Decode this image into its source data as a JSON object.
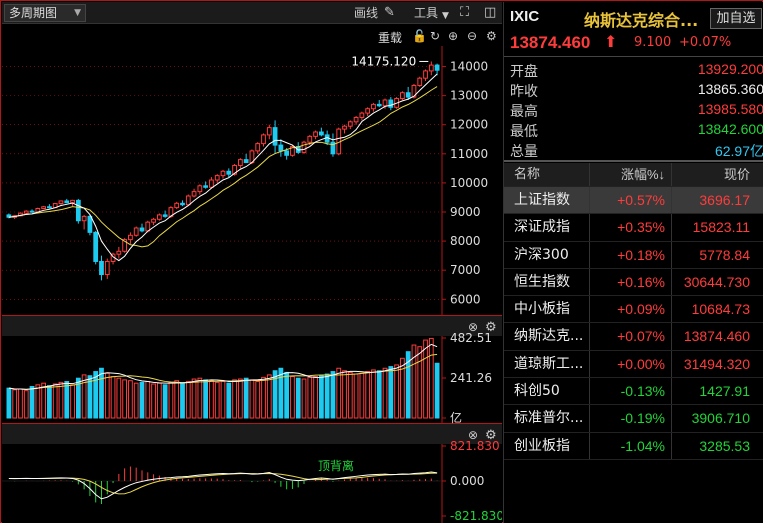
{
  "toolbar": {
    "period_label": "多周期图",
    "draw_label": "画线",
    "tools_label": "工具"
  },
  "kline": {
    "reset_label": "重载",
    "max_annotation": "14175.120",
    "price_ticks": [
      "14000",
      "13000",
      "12000",
      "11000",
      "10000",
      "9000",
      "8000",
      "7000",
      "6000"
    ],
    "volume_ticks": [
      "482.51",
      "241.26",
      "亿"
    ],
    "macd_ticks": [
      "821.830",
      "0.000",
      "-821.830"
    ],
    "macd_annotation": "顶背离",
    "colors": {
      "up": "#ff3c3c",
      "down": "#1ecbf0",
      "ma_fast": "#ffffff",
      "ma_slow": "#e8d84a",
      "grid": "#b01818"
    }
  },
  "quote": {
    "symbol": "IXIC",
    "name": "纳斯达克综合...",
    "add_fav": "加自选",
    "price": "13874.460",
    "change": "9.100",
    "change_pct": "+0.07%",
    "stats": [
      {
        "label": "开盘",
        "value": "13929.200",
        "color": "red"
      },
      {
        "label": "昨收",
        "value": "13865.360",
        "color": "white"
      },
      {
        "label": "最高",
        "value": "13985.580",
        "color": "red"
      },
      {
        "label": "最低",
        "value": "13842.600",
        "color": "green"
      },
      {
        "label": "总量",
        "value": "62.97亿",
        "color": "cyan"
      }
    ]
  },
  "index_table": {
    "headers": [
      "名称",
      "涨幅%↓",
      "现价"
    ],
    "rows": [
      {
        "name": "上证指数",
        "pct": "+0.57%",
        "price": "3696.17",
        "color": "red"
      },
      {
        "name": "深证成指",
        "pct": "+0.35%",
        "price": "15823.11",
        "color": "red"
      },
      {
        "name": "沪深300",
        "pct": "+0.18%",
        "price": "5778.84",
        "color": "red"
      },
      {
        "name": "恒生指数",
        "pct": "+0.16%",
        "price": "30644.730",
        "color": "red"
      },
      {
        "name": "中小板指",
        "pct": "+0.09%",
        "price": "10684.73",
        "color": "red"
      },
      {
        "name": "纳斯达克...",
        "pct": "+0.07%",
        "price": "13874.460",
        "color": "red"
      },
      {
        "name": "道琼斯工...",
        "pct": "+0.00%",
        "price": "31494.320",
        "color": "red"
      },
      {
        "name": "科创50",
        "pct": "-0.13%",
        "price": "1427.91",
        "color": "green"
      },
      {
        "name": "标准普尔...",
        "pct": "-0.19%",
        "price": "3906.710",
        "color": "green"
      },
      {
        "name": "创业板指",
        "pct": "-1.04%",
        "price": "3285.53",
        "color": "green"
      }
    ]
  },
  "chart_data": {
    "type": "candlestick",
    "price_range": [
      5700,
      14500
    ],
    "candles": [
      [
        8900,
        8950,
        8780,
        8820
      ],
      [
        8820,
        8900,
        8760,
        8870
      ],
      [
        8870,
        8990,
        8850,
        8960
      ],
      [
        8960,
        9060,
        8930,
        9030
      ],
      [
        9030,
        9090,
        8970,
        9000
      ],
      [
        9000,
        9150,
        8980,
        9120
      ],
      [
        9120,
        9210,
        9100,
        9180
      ],
      [
        9180,
        9270,
        9120,
        9150
      ],
      [
        9150,
        9310,
        9140,
        9290
      ],
      [
        9290,
        9400,
        9250,
        9380
      ],
      [
        9380,
        9450,
        9300,
        9320
      ],
      [
        9320,
        9420,
        9200,
        9400
      ],
      [
        9400,
        9450,
        8600,
        8700
      ],
      [
        8700,
        8900,
        8400,
        8850
      ],
      [
        8850,
        8900,
        8200,
        8300
      ],
      [
        8300,
        8350,
        7200,
        7300
      ],
      [
        7300,
        7500,
        6650,
        6850
      ],
      [
        6850,
        7400,
        6700,
        7300
      ],
      [
        7300,
        7600,
        7200,
        7550
      ],
      [
        7550,
        7800,
        7400,
        7650
      ],
      [
        7650,
        8100,
        7600,
        8050
      ],
      [
        8050,
        8300,
        7900,
        8200
      ],
      [
        8200,
        8500,
        8150,
        8450
      ],
      [
        8450,
        8600,
        8300,
        8350
      ],
      [
        8350,
        8700,
        8300,
        8650
      ],
      [
        8650,
        8800,
        8550,
        8750
      ],
      [
        8750,
        8950,
        8700,
        8900
      ],
      [
        8900,
        9050,
        8800,
        8850
      ],
      [
        8850,
        9200,
        8800,
        9150
      ],
      [
        9150,
        9350,
        9100,
        9300
      ],
      [
        9300,
        9400,
        9200,
        9250
      ],
      [
        9250,
        9600,
        9220,
        9550
      ],
      [
        9550,
        9800,
        9500,
        9700
      ],
      [
        9700,
        9950,
        9600,
        9900
      ],
      [
        9900,
        10050,
        9800,
        9850
      ],
      [
        9850,
        10200,
        9800,
        10100
      ],
      [
        10100,
        10300,
        10000,
        10250
      ],
      [
        10250,
        10450,
        10150,
        10400
      ],
      [
        10400,
        10500,
        10200,
        10300
      ],
      [
        10300,
        10650,
        10250,
        10600
      ],
      [
        10600,
        10850,
        10500,
        10800
      ],
      [
        10800,
        11000,
        10700,
        10700
      ],
      [
        10700,
        11150,
        10650,
        11100
      ],
      [
        11100,
        11400,
        11000,
        11350
      ],
      [
        11350,
        11700,
        11250,
        11650
      ],
      [
        11650,
        12000,
        11500,
        11900
      ],
      [
        11900,
        12150,
        11000,
        11300
      ],
      [
        11300,
        11500,
        10900,
        11100
      ],
      [
        11100,
        11200,
        10800,
        10950
      ],
      [
        10950,
        11300,
        10900,
        11250
      ],
      [
        11250,
        11400,
        11000,
        11050
      ],
      [
        11050,
        11450,
        11000,
        11400
      ],
      [
        11400,
        11650,
        11300,
        11600
      ],
      [
        11600,
        11800,
        11500,
        11750
      ],
      [
        11750,
        11900,
        11600,
        11650
      ],
      [
        11650,
        11800,
        11300,
        11400
      ],
      [
        11400,
        11700,
        10900,
        11000
      ],
      [
        11000,
        11900,
        10950,
        11850
      ],
      [
        11850,
        12000,
        11700,
        11950
      ],
      [
        11950,
        12150,
        11850,
        12100
      ],
      [
        12100,
        12300,
        12000,
        12250
      ],
      [
        12250,
        12450,
        12150,
        12400
      ],
      [
        12400,
        12600,
        12300,
        12550
      ],
      [
        12550,
        12750,
        12450,
        12700
      ],
      [
        12700,
        12850,
        12600,
        12650
      ],
      [
        12650,
        12900,
        12550,
        12850
      ],
      [
        12850,
        12950,
        12500,
        12600
      ],
      [
        12600,
        12950,
        12550,
        12900
      ],
      [
        12900,
        13150,
        12850,
        13100
      ],
      [
        13100,
        13300,
        12850,
        12950
      ],
      [
        12950,
        13400,
        12900,
        13350
      ],
      [
        13350,
        13650,
        13300,
        13600
      ],
      [
        13600,
        13900,
        13500,
        13850
      ],
      [
        13850,
        14175,
        13700,
        14050
      ],
      [
        14050,
        14100,
        13700,
        13874
      ]
    ],
    "volume_range": [
      0,
      482.51
    ],
    "volumes": [
      180,
      170,
      175,
      165,
      190,
      200,
      210,
      195,
      205,
      215,
      220,
      200,
      240,
      260,
      255,
      280,
      300,
      270,
      250,
      240,
      230,
      225,
      210,
      215,
      220,
      205,
      210,
      200,
      215,
      225,
      210,
      220,
      235,
      240,
      230,
      225,
      215,
      220,
      210,
      230,
      235,
      240,
      230,
      220,
      245,
      260,
      285,
      300,
      275,
      250,
      240,
      235,
      245,
      250,
      255,
      265,
      280,
      300,
      285,
      275,
      265,
      270,
      280,
      290,
      285,
      300,
      310,
      320,
      360,
      400,
      440,
      430,
      470,
      480,
      330
    ],
    "macd_range": [
      -821.83,
      821.83
    ],
    "macd": [
      60,
      55,
      58,
      62,
      60,
      58,
      62,
      66,
      70,
      72,
      70,
      60,
      20,
      -60,
      -180,
      -320,
      -420,
      -380,
      -300,
      -220,
      -150,
      -90,
      -40,
      -10,
      20,
      40,
      60,
      70,
      80,
      95,
      100,
      110,
      125,
      140,
      150,
      160,
      170,
      175,
      170,
      175,
      185,
      175,
      160,
      165,
      180,
      200,
      150,
      90,
      40,
      20,
      10,
      20,
      40,
      60,
      70,
      60,
      40,
      60,
      80,
      95,
      110,
      125,
      140,
      150,
      155,
      160,
      150,
      155,
      165,
      160,
      175,
      185,
      195,
      210,
      190
    ]
  }
}
